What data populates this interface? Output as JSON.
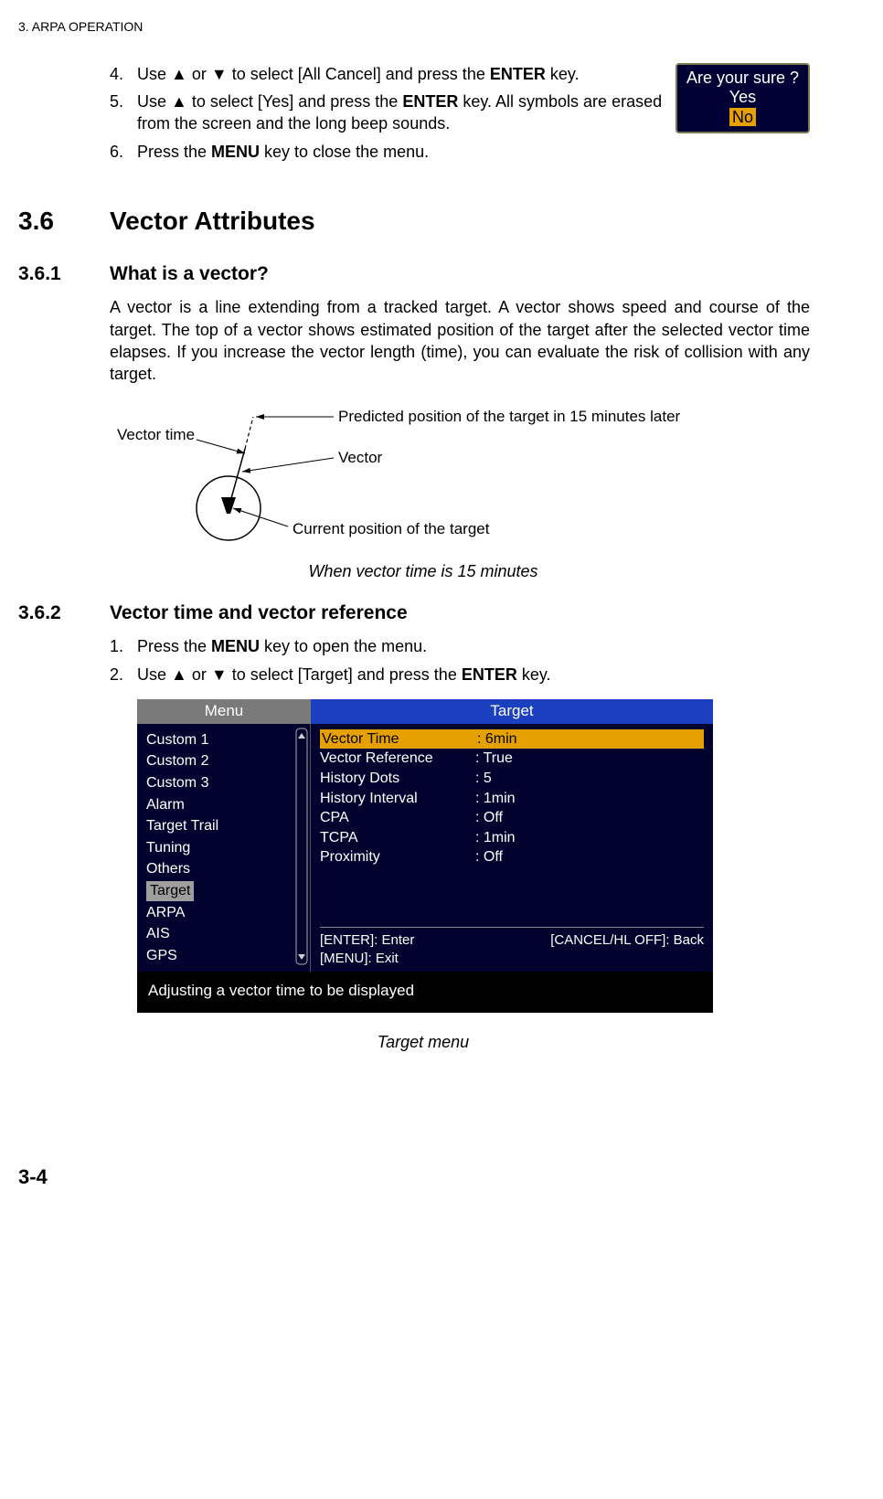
{
  "chapter_header": "3.  ARPA OPERATION",
  "steps_a": [
    {
      "num": "4.",
      "pre": "Use ",
      "mid": " or ",
      "post": " to select [All Cancel] and press the ",
      "key": "ENTER",
      "tail": " key."
    },
    {
      "num": "5.",
      "pre": "Use ",
      "mid": " to select [Yes] and press the ",
      "post": "",
      "key": "ENTER",
      "tail": " key. All symbols are erased from the screen and the long beep sounds."
    },
    {
      "num": "6.",
      "pre": "Press the ",
      "mid": "",
      "post": "",
      "key": "MENU",
      "tail": " key to close the menu."
    }
  ],
  "dialog": {
    "q": "Are your sure ?",
    "yes": "Yes",
    "no": "No"
  },
  "section": {
    "num": "3.6",
    "title": "Vector Attributes"
  },
  "subsection1": {
    "num": "3.6.1",
    "title": "What is a vector?"
  },
  "vector_para": "A vector is a line extending from a tracked target. A vector shows speed and course of the target. The top of a vector shows estimated position of the target after the selected vector time elapses. If you increase the vector length (time), you can evaluate the risk of collision with any target.",
  "vec_labels": {
    "predicted": "Predicted position of the target in 15 minutes later",
    "vector_time": "Vector time",
    "vector": "Vector",
    "current": "Current position of the target"
  },
  "vec_caption": "When vector time is 15 minutes",
  "subsection2": {
    "num": "3.6.2",
    "title": "Vector time and vector reference"
  },
  "steps_b": [
    {
      "num": "1.",
      "pre": "Press the ",
      "key": "MENU",
      "tail": " key to open the menu."
    },
    {
      "num": "2.",
      "pre": "Use ",
      "mid": " or ",
      "post": " to select [Target] and press the ",
      "key": "ENTER",
      "tail": " key."
    }
  ],
  "menu": {
    "left_title": "Menu",
    "right_title": "Target",
    "left_items": [
      "Custom 1",
      "Custom 2",
      "Custom 3",
      "Alarm",
      "Target  Trail",
      "Tuning",
      "Others",
      "Target",
      "ARPA",
      "AIS",
      "GPS"
    ],
    "left_sel_index": 7,
    "right_items": [
      {
        "k": "Vector Time",
        "v": ": 6min",
        "sel": true
      },
      {
        "k": "Vector Reference",
        "v": ": True"
      },
      {
        "k": "History Dots",
        "v": ": 5"
      },
      {
        "k": "History Interval",
        "v": ": 1min"
      },
      {
        "k": "CPA",
        "v": ": Off"
      },
      {
        "k": "TCPA",
        "v": ": 1min"
      },
      {
        "k": "Proximity",
        "v": ": Off"
      }
    ],
    "hints_l": "[ENTER]: Enter",
    "hints_r": "[CANCEL/HL OFF]: Back",
    "hints_b": "[MENU]: Exit",
    "tip": "Adjusting a vector time to be displayed"
  },
  "menu_caption": "Target menu",
  "page_number": "3-4"
}
